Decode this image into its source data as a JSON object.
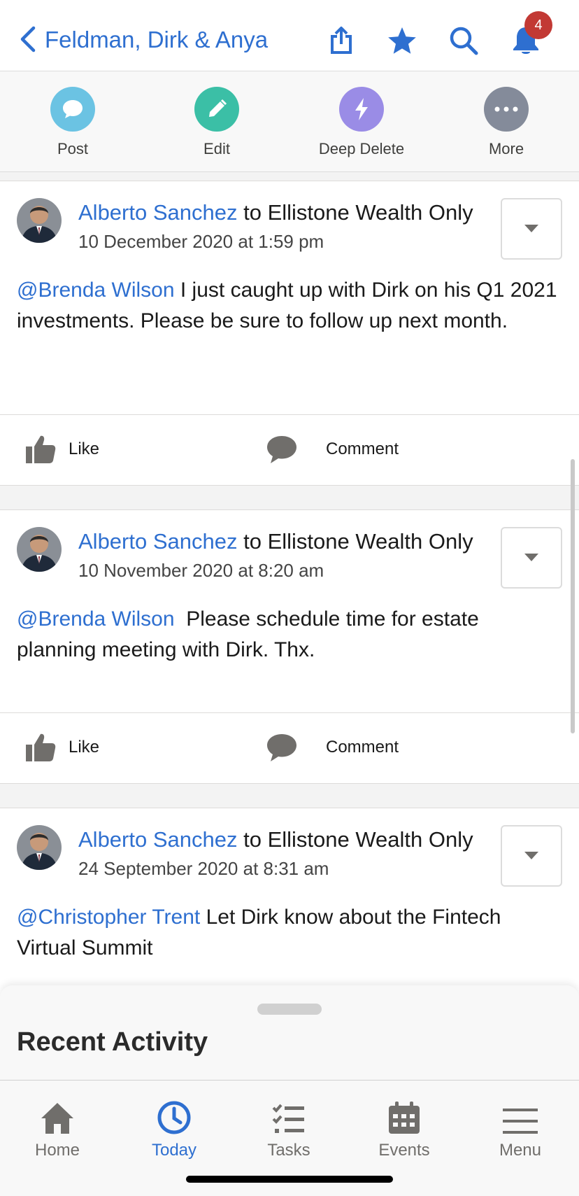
{
  "header": {
    "title": "Feldman, Dirk & Anya",
    "notification_count": "4"
  },
  "actions": [
    {
      "label": "Post",
      "color": "#6bc3e3"
    },
    {
      "label": "Edit",
      "color": "#3bbfa6"
    },
    {
      "label": "Deep Delete",
      "color": "#9a8ce6"
    },
    {
      "label": "More",
      "color": "#848b9a"
    }
  ],
  "posts": [
    {
      "author": "Alberto Sanchez",
      "audience": "to Ellistone Wealth Only",
      "date": "10 December 2020 at 1:59 pm",
      "mention": "@Brenda Wilson",
      "text": " I just caught up with Dirk on his Q1 2021 investments. Please be sure to follow up next month.",
      "like_label": "Like",
      "comment_label": "Comment"
    },
    {
      "author": "Alberto Sanchez",
      "audience": "to Ellistone Wealth Only",
      "date": "10 November 2020 at 8:20 am",
      "mention": "@Brenda Wilson",
      "text": "  Please schedule time for estate planning meeting with Dirk. Thx.",
      "like_label": "Like",
      "comment_label": "Comment"
    },
    {
      "author": "Alberto Sanchez",
      "audience": "to Ellistone Wealth Only",
      "date": "24 September 2020 at 8:31 am",
      "mention": "@Christopher Trent",
      "text": " Let Dirk know about the Fintech Virtual Summit"
    }
  ],
  "sheet": {
    "title": "Recent Activity"
  },
  "tabs": [
    {
      "label": "Home"
    },
    {
      "label": "Today"
    },
    {
      "label": "Tasks"
    },
    {
      "label": "Events"
    },
    {
      "label": "Menu"
    }
  ],
  "colors": {
    "accent": "#2e6fd0",
    "badge": "#c23934"
  }
}
